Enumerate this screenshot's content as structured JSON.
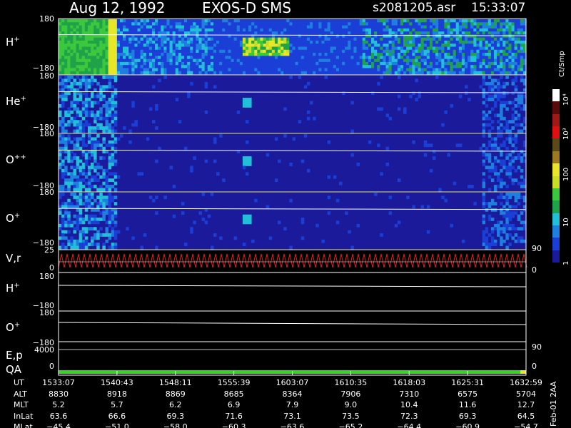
{
  "header": {
    "date": "Aug 12, 1992",
    "mission": "EXOS-D SMS",
    "file": "s2081205.asr",
    "time": "15:33:07"
  },
  "colorbar": {
    "label": "Ct/Smp",
    "ticks": [
      "1",
      "10",
      "100",
      "10³",
      "10⁴"
    ],
    "colors": [
      "#1a1a9a",
      "#1b3fd6",
      "#1f7fe0",
      "#22c0d8",
      "#1fa24a",
      "#3cc83c",
      "#c8dc28",
      "#e8e628",
      "#9c7a22",
      "#5a4a1a",
      "#e01010",
      "#a01818",
      "#5a0a0a",
      "#ffffff"
    ]
  },
  "panels": [
    {
      "id": "h-plus",
      "label": "H",
      "sup": "+",
      "ymax": "180",
      "ymin": "−180"
    },
    {
      "id": "he-plus",
      "label": "He",
      "sup": "+",
      "ymax": "180",
      "ymin": "−180"
    },
    {
      "id": "o-plus-plus",
      "label": "O",
      "sup": "++",
      "ymax": "180",
      "ymin": "−180"
    },
    {
      "id": "o-plus",
      "label": "O",
      "sup": "+",
      "ymax": "180",
      "ymin": "−180"
    },
    {
      "id": "vr",
      "label": "V,r",
      "ymax": "25",
      "ymin": "0",
      "rmax": "90",
      "rmin": "0"
    },
    {
      "id": "h-plus-angle",
      "label": "H",
      "sup": "+",
      "ymax": "180",
      "ymin": "−180"
    },
    {
      "id": "o-plus-angle",
      "label": "O",
      "sup": "+",
      "ymax": "180",
      "ymin": "−180"
    },
    {
      "id": "ep",
      "label": "E,p",
      "ymax": "4000",
      "rmax": "90"
    },
    {
      "id": "qa",
      "label": "QA",
      "ymin": "0",
      "rmin": "0"
    }
  ],
  "chart_data": {
    "type": "heatmap",
    "title": "Aug 12, 1992   EXOS-D SMS",
    "x_label": "UT",
    "x_ticks": [
      "1533:07",
      "1540:43",
      "1548:11",
      "1555:39",
      "1603:07",
      "1610:35",
      "1618:03",
      "1625:31",
      "1632:59"
    ],
    "orbit_rows": [
      {
        "name": "UT",
        "values": [
          "1533:07",
          "1540:43",
          "1548:11",
          "1555:39",
          "1603:07",
          "1610:35",
          "1618:03",
          "1625:31",
          "1632:59"
        ]
      },
      {
        "name": "ALT",
        "values": [
          "8830",
          "8918",
          "8869",
          "8685",
          "8364",
          "7906",
          "7310",
          "6575",
          "5704"
        ]
      },
      {
        "name": "MLT",
        "values": [
          "5.2",
          "5.7",
          "6.2",
          "6.9",
          "7.9",
          "9.0",
          "10.4",
          "11.6",
          "12.7"
        ]
      },
      {
        "name": "InLat",
        "values": [
          "63.6",
          "66.6",
          "69.3",
          "71.6",
          "73.1",
          "73.5",
          "72.3",
          "69.3",
          "64.5"
        ]
      },
      {
        "name": "MLat",
        "values": [
          "−45.4",
          "−51.0",
          "−58.0",
          "−60.3",
          "−63.6",
          "−65.2",
          "−64.4",
          "−60.9",
          "−54.7"
        ]
      }
    ],
    "y_range": [
      -180,
      180
    ],
    "colorbar_label": "Ct/Smp",
    "colorbar_ticks": [
      "1",
      "10",
      "100",
      "10³",
      "10⁴"
    ],
    "side_note": "Feb-01 2AA"
  }
}
